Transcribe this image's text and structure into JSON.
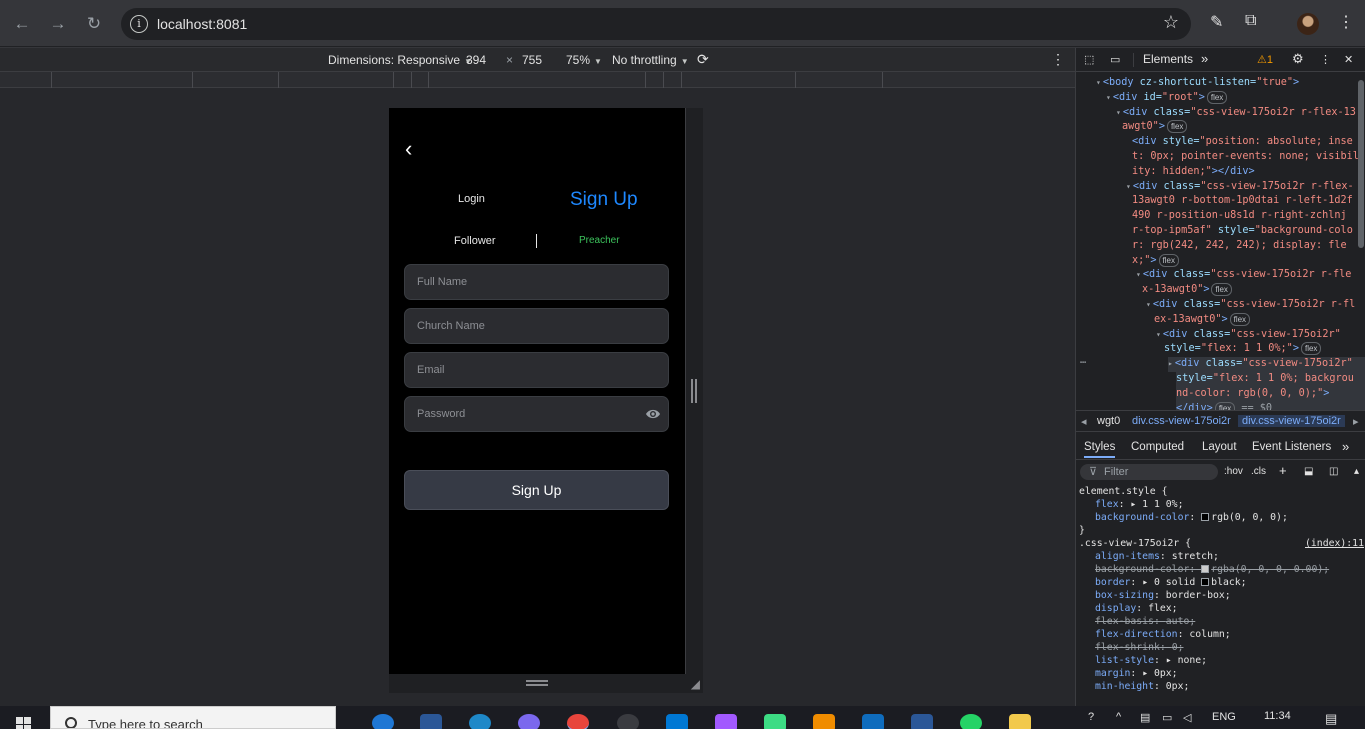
{
  "browser": {
    "url": "localhost:8081"
  },
  "device_toolbar": {
    "dimensions_label": "Dimensions: Responsive",
    "width": "394",
    "times": "×",
    "height": "755",
    "zoom": "75%",
    "throttling": "No throttling"
  },
  "app": {
    "tabs": {
      "login": "Login",
      "signup": "Sign Up"
    },
    "roles": {
      "follower": "Follower",
      "preacher": "Preacher"
    },
    "fields": {
      "full_name": "Full Name",
      "church_name": "Church Name",
      "email": "Email",
      "password": "Password"
    },
    "submit_label": "Sign Up",
    "colors": {
      "accent": "#1e88ff",
      "preacher": "#3cc35c",
      "button": "#363a45"
    }
  },
  "devtools": {
    "tabs": {
      "elements": "Elements",
      "more": "»"
    },
    "warning_count": "1",
    "dom_lines": [
      {
        "indent": 20,
        "arrow": "▾",
        "tag": "<body ",
        "attrs": [
          [
            "cz-shortcut-listen",
            "\"true\""
          ]
        ],
        "close": ">",
        "badge": ""
      },
      {
        "indent": 30,
        "arrow": "▾",
        "tag": "<div ",
        "attrs": [
          [
            "id",
            "\"root\""
          ]
        ],
        "close": ">",
        "badge": "flex"
      },
      {
        "indent": 40,
        "arrow": "▾",
        "tag": "<div ",
        "attrs": [
          [
            "class",
            "\"css-view-175oi2r r-flex-13"
          ]
        ],
        "close": "",
        "badge": ""
      },
      {
        "indent": 46,
        "arrow": "",
        "tag": "",
        "attrs": [
          [
            "",
            "awgt0\""
          ]
        ],
        "close": ">",
        "badge": "flex"
      },
      {
        "indent": 56,
        "arrow": "",
        "tag": "<div ",
        "attrs": [
          [
            "style",
            "\"position: absolute; inse"
          ]
        ],
        "close": "",
        "badge": ""
      },
      {
        "indent": 56,
        "arrow": "",
        "tag": "",
        "attrs": [
          [
            "",
            "t: 0px; pointer-events: none; visibil"
          ]
        ],
        "close": "",
        "badge": ""
      },
      {
        "indent": 56,
        "arrow": "",
        "tag": "",
        "attrs": [
          [
            "",
            "ity: hidden;\""
          ]
        ],
        "close": "></div>",
        "badge": ""
      },
      {
        "indent": 50,
        "arrow": "▾",
        "tag": "<div ",
        "attrs": [
          [
            "class",
            "\"css-view-175oi2r r-flex-"
          ]
        ],
        "close": "",
        "badge": ""
      },
      {
        "indent": 56,
        "arrow": "",
        "tag": "",
        "attrs": [
          [
            "",
            "13awgt0 r-bottom-1p0dtai r-left-1d2f"
          ]
        ],
        "close": "",
        "badge": ""
      },
      {
        "indent": 56,
        "arrow": "",
        "tag": "",
        "attrs": [
          [
            "",
            "490 r-position-u8s1d r-right-zchlnj"
          ]
        ],
        "close": "",
        "badge": ""
      },
      {
        "indent": 56,
        "arrow": "",
        "tag": "",
        "attrs": [
          [
            "",
            "r-top-ipm5af\" "
          ],
          [
            "style",
            "\"background-colo"
          ]
        ],
        "close": "",
        "badge": ""
      },
      {
        "indent": 56,
        "arrow": "",
        "tag": "",
        "attrs": [
          [
            "",
            "r: rgb(242, 242, 242); display: fle"
          ]
        ],
        "close": "",
        "badge": ""
      },
      {
        "indent": 56,
        "arrow": "",
        "tag": "",
        "attrs": [
          [
            "",
            "x;\""
          ]
        ],
        "close": ">",
        "badge": "flex"
      },
      {
        "indent": 60,
        "arrow": "▾",
        "tag": "<div ",
        "attrs": [
          [
            "class",
            "\"css-view-175oi2r r-fle"
          ]
        ],
        "close": "",
        "badge": ""
      },
      {
        "indent": 66,
        "arrow": "",
        "tag": "",
        "attrs": [
          [
            "",
            "x-13awgt0\""
          ]
        ],
        "close": ">",
        "badge": "flex"
      },
      {
        "indent": 70,
        "arrow": "▾",
        "tag": "<div ",
        "attrs": [
          [
            "class",
            "\"css-view-175oi2r r-fl"
          ]
        ],
        "close": "",
        "badge": ""
      },
      {
        "indent": 78,
        "arrow": "",
        "tag": "",
        "attrs": [
          [
            "",
            "ex-13awgt0\""
          ]
        ],
        "close": ">",
        "badge": "flex"
      },
      {
        "indent": 80,
        "arrow": "▾",
        "tag": "<div ",
        "attrs": [
          [
            "class",
            "\"css-view-175oi2r\""
          ]
        ],
        "close": "",
        "badge": ""
      },
      {
        "indent": 88,
        "arrow": "",
        "tag": "",
        "attrs": [
          [
            "style",
            "\"flex: 1 1 0%;\""
          ]
        ],
        "close": ">",
        "badge": "flex"
      },
      {
        "indent": 92,
        "arrow": "▸",
        "tag": "<div ",
        "attrs": [
          [
            "class",
            "\"css-view-175oi2r\""
          ]
        ],
        "close": "",
        "badge": ""
      },
      {
        "indent": 100,
        "arrow": "",
        "tag": "",
        "attrs": [
          [
            "style",
            "\"flex: 1 1 0%; backgrou"
          ]
        ],
        "close": "",
        "badge": ""
      },
      {
        "indent": 100,
        "arrow": "",
        "tag": "",
        "attrs": [
          [
            "",
            "nd-color: rgb(0, 0, 0);\""
          ]
        ],
        "close": ">",
        "badge": ""
      },
      {
        "indent": 100,
        "arrow": "",
        "tag": "</div>",
        "attrs": [],
        "close": "",
        "badge": "flex"
      }
    ],
    "dom_selected_suffix": "== $0",
    "breadcrumbs": [
      "wgt0",
      "div.css-view-175oi2r",
      "div.css-view-175oi2r"
    ],
    "styles_tabs": [
      "Styles",
      "Computed",
      "Layout",
      "Event Listeners",
      "»"
    ],
    "filter_placeholder": "Filter",
    "filter_opts": {
      "hov": ":hov",
      "cls": ".cls"
    },
    "styles_lines": [
      {
        "indent": 3,
        "text": "element.style {",
        "kind": "selector"
      },
      {
        "indent": 19,
        "prop": "flex",
        "value": "▸ 1 1 0%;",
        "kind": "prop"
      },
      {
        "indent": 19,
        "prop": "background-color",
        "value": "rgb(0, 0, 0);",
        "kind": "prop-swatch",
        "swatch": "#000000"
      },
      {
        "indent": 3,
        "text": "}",
        "kind": "selector"
      },
      {
        "indent": 3,
        "text": ".css-view-175oi2r {",
        "kind": "selector",
        "source": "(index):11"
      },
      {
        "indent": 19,
        "prop": "align-items",
        "value": "stretch;",
        "kind": "prop"
      },
      {
        "indent": 19,
        "prop": "background-color",
        "value": "rgba(0, 0, 0, 0.00);",
        "kind": "strike-swatch",
        "swatch": "#cccccc"
      },
      {
        "indent": 19,
        "prop": "border",
        "value": "▸ 0 solid ",
        "kind": "prop-swatch-after",
        "after": "black;",
        "swatch": "#000000"
      },
      {
        "indent": 19,
        "prop": "box-sizing",
        "value": "border-box;",
        "kind": "prop"
      },
      {
        "indent": 19,
        "prop": "display",
        "value": "flex;",
        "kind": "prop"
      },
      {
        "indent": 19,
        "prop": "flex-basis",
        "value": "auto;",
        "kind": "strike"
      },
      {
        "indent": 19,
        "prop": "flex-direction",
        "value": "column;",
        "kind": "prop"
      },
      {
        "indent": 19,
        "prop": "flex-shrink",
        "value": "0;",
        "kind": "strike"
      },
      {
        "indent": 19,
        "prop": "list-style",
        "value": "▸ none;",
        "kind": "prop"
      },
      {
        "indent": 19,
        "prop": "margin",
        "value": "▸ 0px;",
        "kind": "prop"
      },
      {
        "indent": 19,
        "prop": "min-height",
        "value": "0px;",
        "kind": "prop"
      }
    ]
  },
  "taskbar": {
    "search_placeholder": "Type here to search",
    "lang": "ENG",
    "time": "11:34"
  }
}
